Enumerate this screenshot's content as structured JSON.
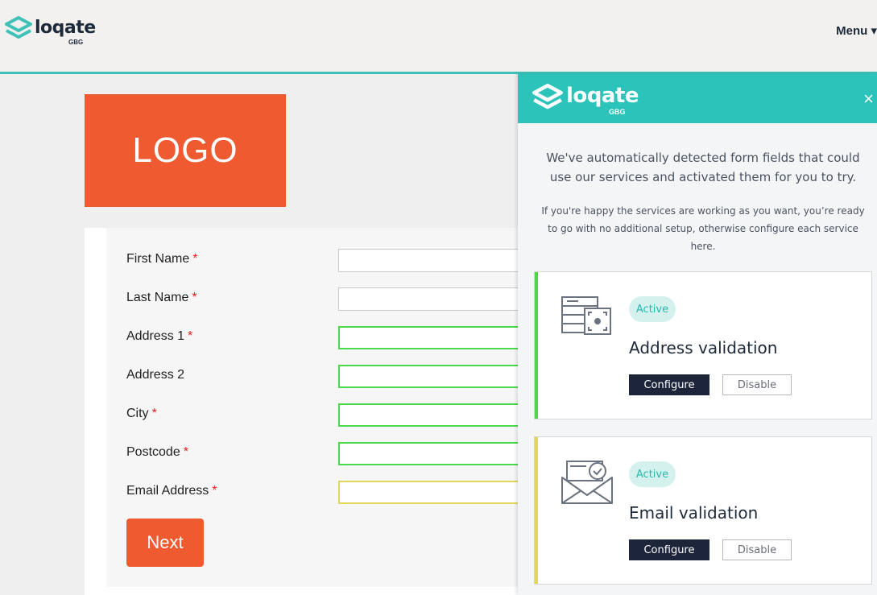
{
  "header": {
    "brand_name": "loqate",
    "brand_sub": "GBG",
    "menu_label": "Menu",
    "menu_caret": "▾"
  },
  "page": {
    "logo_text": "LOGO",
    "form": {
      "fields": [
        {
          "label": "First Name",
          "required": "*"
        },
        {
          "label": "Last Name",
          "required": "*"
        },
        {
          "label": "Address 1",
          "required": "*"
        },
        {
          "label": "Address 2",
          "required": ""
        },
        {
          "label": "City",
          "required": "*"
        },
        {
          "label": "Postcode",
          "required": "*"
        },
        {
          "label": "Email Address",
          "required": "*"
        }
      ],
      "next_label": "Next"
    }
  },
  "panel": {
    "brand_name": "loqate",
    "brand_sub": "GBG",
    "close_glyph": "×",
    "intro": "We've automatically detected form fields that could use our services and activated them for you to try.",
    "subintro": "If you're happy the services are working as you want, you’re ready to go with no additional setup, otherwise configure each service here.",
    "cards": [
      {
        "status": "Active",
        "title": "Address validation",
        "configure": "Configure",
        "disable": "Disable",
        "icon": "address-form-icon",
        "accent": "#4bd84b"
      },
      {
        "status": "Active",
        "title": "Email validation",
        "configure": "Configure",
        "disable": "Disable",
        "icon": "email-check-icon",
        "accent": "#e3d65a"
      }
    ]
  },
  "colors": {
    "brand_teal": "#2cc3bb",
    "cta_orange": "#f05a30",
    "dark_navy": "#1c2539"
  }
}
